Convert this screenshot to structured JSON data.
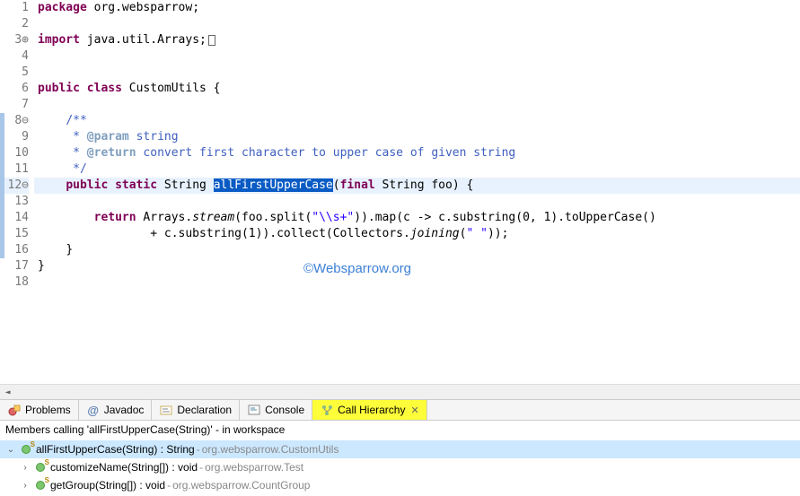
{
  "editor": {
    "lines": [
      {
        "n": 1,
        "ann": ""
      },
      {
        "n": 2,
        "ann": ""
      },
      {
        "n": 3,
        "ann": "⊕"
      },
      {
        "n": 4,
        "ann": ""
      },
      {
        "n": 5,
        "ann": ""
      },
      {
        "n": 6,
        "ann": ""
      },
      {
        "n": 7,
        "ann": ""
      },
      {
        "n": 8,
        "ann": "⊖"
      },
      {
        "n": 9,
        "ann": ""
      },
      {
        "n": 10,
        "ann": ""
      },
      {
        "n": 11,
        "ann": ""
      },
      {
        "n": 12,
        "ann": "⊖"
      },
      {
        "n": 13,
        "ann": ""
      },
      {
        "n": 14,
        "ann": ""
      },
      {
        "n": 15,
        "ann": ""
      },
      {
        "n": 16,
        "ann": ""
      },
      {
        "n": 17,
        "ann": ""
      },
      {
        "n": 18,
        "ann": ""
      }
    ],
    "tokens": {
      "package": "package",
      "pkg_name": "org.websparrow;",
      "import": "import",
      "import_name": "java.util.Arrays;",
      "public": "public",
      "static_kw": "static",
      "class": "class",
      "class_name": "CustomUtils {",
      "cmt_open": "/**",
      "cmt_param": "@param",
      "cmt_param_txt": " string",
      "cmt_return": "@return",
      "cmt_return_txt": " convert first character to upper case of given string",
      "cmt_close": "*/",
      "string_type": "String ",
      "method_name": "allFirstUpperCase",
      "final": "final",
      "param_rest": " String foo) {",
      "return": "return",
      "l14a": " Arrays.",
      "l14_stream": "stream",
      "l14b": "(foo.split(",
      "l14_str": "\"\\\\s+\"",
      "l14c": ")).map(c -> c.substring(0, 1).toUpperCase()",
      "l15a": "                + c.substring(1)).collect(Collectors.",
      "l15_joining": "joining",
      "l15b": "(",
      "l15_str": "\" \"",
      "l15c": "));",
      "brace_close": "}"
    },
    "watermark": "©Websparrow.org"
  },
  "tabs": [
    {
      "icon": "problems-icon",
      "label": "Problems"
    },
    {
      "icon": "javadoc-icon",
      "label": "Javadoc"
    },
    {
      "icon": "declaration-icon",
      "label": "Declaration"
    },
    {
      "icon": "console-icon",
      "label": "Console"
    },
    {
      "icon": "call-hierarchy-icon",
      "label": "Call Hierarchy"
    }
  ],
  "panel": {
    "title": "Members calling 'allFirstUpperCase(String)' - in workspace",
    "tree": [
      {
        "depth": 0,
        "expand": "v",
        "name": "allFirstUpperCase(String) : String",
        "loc": "org.websparrow.CustomUtils",
        "selected": true
      },
      {
        "depth": 1,
        "expand": ">",
        "name": "customizeName(String[]) : void",
        "loc": "org.websparrow.Test",
        "selected": false
      },
      {
        "depth": 1,
        "expand": ">",
        "name": "getGroup(String[]) : void",
        "loc": "org.websparrow.CountGroup",
        "selected": false
      }
    ]
  }
}
